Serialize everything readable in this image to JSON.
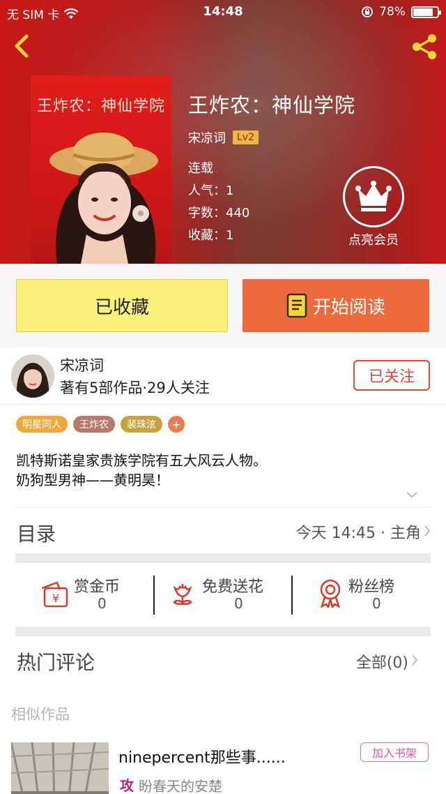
{
  "status_bar": {
    "carrier": "无 SIM 卡",
    "time": "14:48",
    "battery": "78%"
  },
  "book": {
    "cover_text": "王炸农：神仙学院",
    "title": "王炸农：神仙学院",
    "author": "宋凉词",
    "level": "Lv2",
    "status": "连载",
    "popularity": "人气：1",
    "word_count": "字数：440",
    "favorites": "收藏：1"
  },
  "vip": {
    "label": "点亮会员"
  },
  "actions": {
    "favorite_label": "已收藏",
    "read_label": "开始阅读"
  },
  "author_card": {
    "name": "宋凉词",
    "stats": "著有5部作品·29人关注",
    "follow_label": "已关注"
  },
  "tags": [
    {
      "label": "明星同人",
      "color": "#f2a93b"
    },
    {
      "label": "王炸农",
      "color": "#b9776a"
    },
    {
      "label": "裴珠泫",
      "color": "#c9a13d"
    },
    {
      "label": "+",
      "color": "#ee7a52"
    }
  ],
  "description": {
    "line1": "凯特斯诺皇家贵族学院有五大风云人物。",
    "line2": "奶狗型男神——黄明昊！"
  },
  "catalog": {
    "label": "目录",
    "latest": "今天 14:45 · 主角"
  },
  "rewards": {
    "coins_label": "赏金币",
    "coins_count": "0",
    "flowers_label": "免费送花",
    "flowers_count": "0",
    "fans_label": "粉丝榜",
    "fans_count": "0"
  },
  "comments": {
    "label": "热门评论",
    "all_label": "全部(0)"
  },
  "similar": {
    "label": "相似作品",
    "items": [
      {
        "title": "ninepercent那些事......",
        "tag": "攻",
        "author": "盼春天的安楚",
        "add_label": "加入书架"
      }
    ]
  },
  "colors": {
    "accent_orange": "#ec6a3c",
    "favorite_yellow": "#fbf07a",
    "follow_red": "#e0483a",
    "hero_red": "#c81818"
  }
}
